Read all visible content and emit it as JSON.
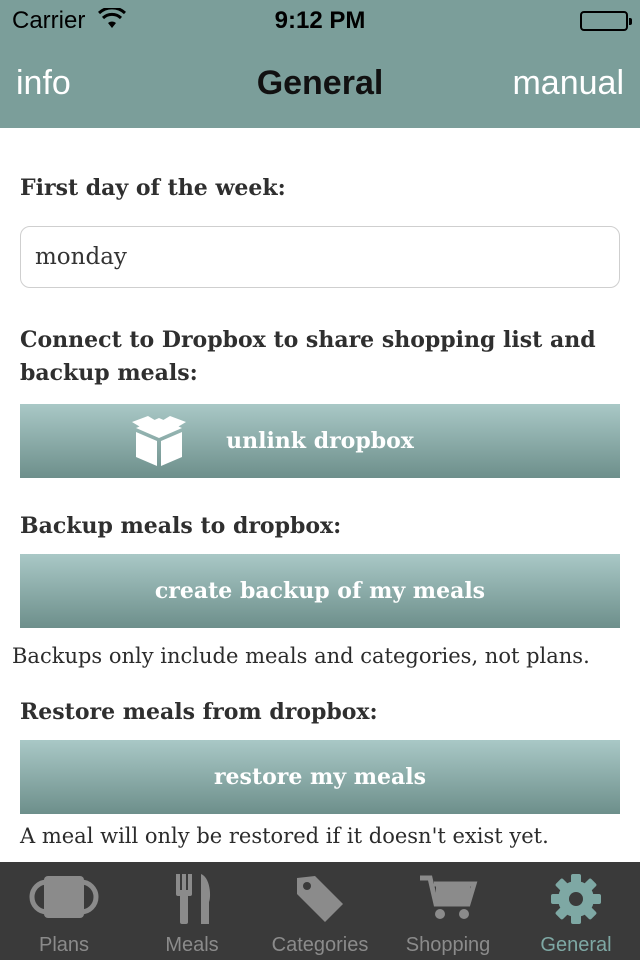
{
  "status_bar": {
    "carrier": "Carrier",
    "time": "9:12 PM"
  },
  "nav": {
    "left_label": "info",
    "title": "General",
    "right_label": "manual"
  },
  "settings": {
    "first_day_label": "First day of the week:",
    "first_day_value": "monday",
    "dropbox_label_line1": "Connect to Dropbox to share shopping list and",
    "dropbox_label_line2": "backup meals:",
    "unlink_button": "unlink dropbox",
    "backup_label": "Backup meals to dropbox:",
    "backup_button": "create backup of my meals",
    "backup_note": "Backups only include meals and categories, not plans.",
    "restore_label": "Restore meals from dropbox:",
    "restore_button": "restore my meals",
    "restore_note": "A meal will only be restored if it doesn't exist yet."
  },
  "tabs": [
    {
      "label": "Plans",
      "icon": "plans-icon"
    },
    {
      "label": "Meals",
      "icon": "fork-knife-icon"
    },
    {
      "label": "Categories",
      "icon": "tag-icon"
    },
    {
      "label": "Shopping",
      "icon": "cart-icon"
    },
    {
      "label": "General",
      "icon": "gear-icon",
      "active": true
    }
  ],
  "colors": {
    "nav_bg": "#7b9e9a",
    "accent": "#7ea8a4",
    "tabbar_bg": "#3a3a3a"
  }
}
